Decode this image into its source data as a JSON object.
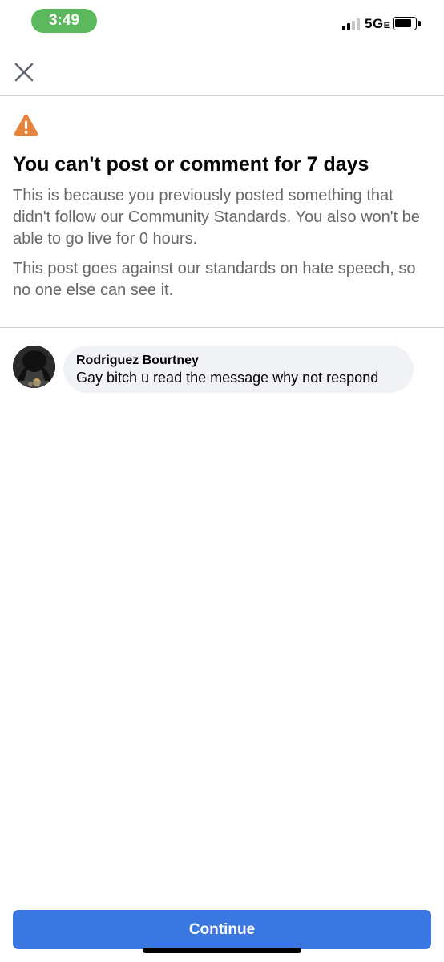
{
  "status_bar": {
    "time": "3:49",
    "network": "5G",
    "network_suffix": "E",
    "signal_icon": "cellular-signal-icon",
    "battery_icon": "battery-icon"
  },
  "header": {
    "close_icon": "close-icon"
  },
  "notice": {
    "icon": "warning-triangle-icon",
    "icon_color": "#e8833a",
    "title": "You can't post or comment for 7 days",
    "body_1": "This is because you previously posted something that didn't follow our Community Standards.  You also won't be able to go  live for 0 hours.",
    "body_2": "This post goes against our standards on hate speech, so no one else can see it."
  },
  "comment": {
    "author": "Rodriguez Bourtney",
    "text": "Gay bitch u read the message why not respond"
  },
  "footer": {
    "continue_label": "Continue",
    "accent_color": "#3b77e0"
  }
}
